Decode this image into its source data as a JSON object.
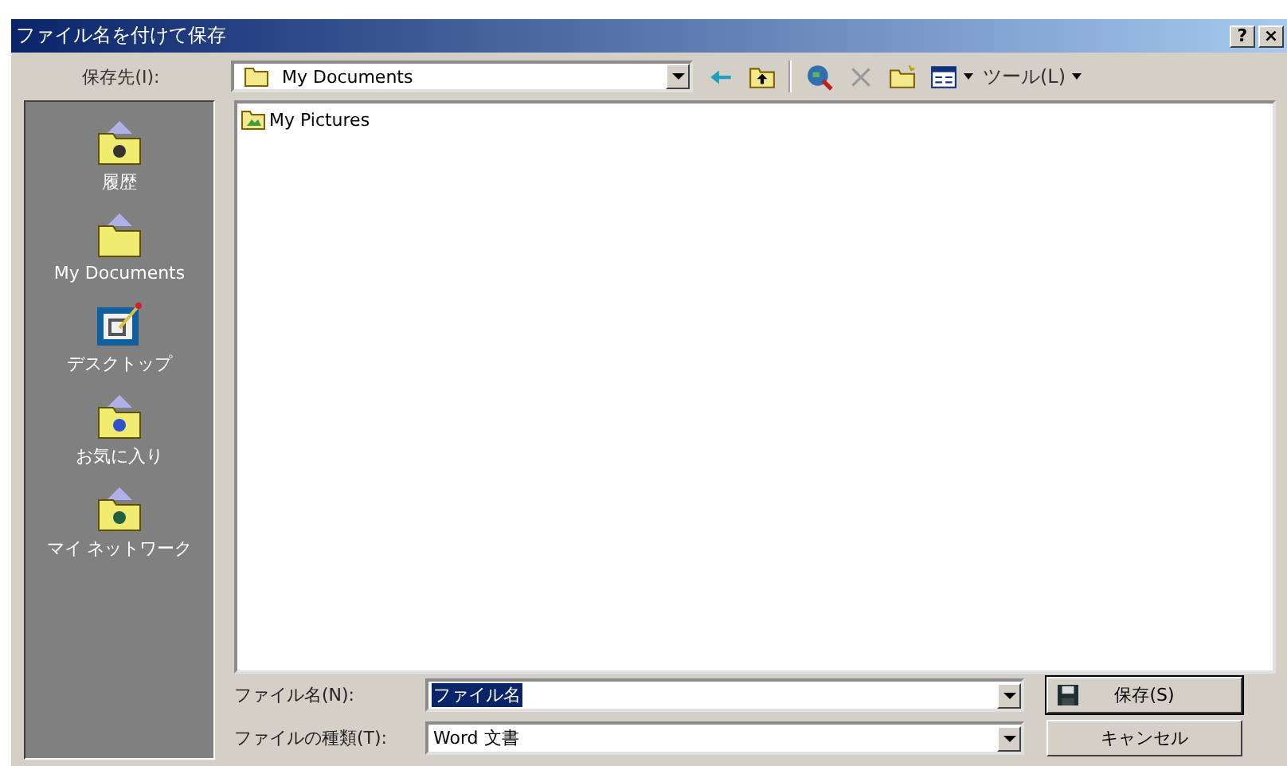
{
  "window": {
    "title": "ファイル名を付けて保存",
    "title_buttons": [
      "?",
      "×"
    ]
  },
  "toolbar": {
    "label": "保存先(I):",
    "location": "My Documents",
    "tools_label": "ツール(L)"
  },
  "places": [
    {
      "label": "履歴",
      "kind": "history"
    },
    {
      "label": "My Documents",
      "kind": "documents"
    },
    {
      "label": "デスクトップ",
      "kind": "desktop"
    },
    {
      "label": "お気に入り",
      "kind": "favorites"
    },
    {
      "label": "マイ ネットワーク",
      "kind": "network"
    }
  ],
  "files": [
    {
      "name": "My Pictures"
    }
  ],
  "form": {
    "filename_label": "ファイル名(N):",
    "filename": "ファイル名",
    "filename_selected": true,
    "type_label": "ファイルの種類(T):",
    "type": "Word 文書"
  },
  "buttons": [
    {
      "label": "保存(S)",
      "kind": "save"
    },
    {
      "label": "キャンセル",
      "kind": "cancel"
    }
  ]
}
